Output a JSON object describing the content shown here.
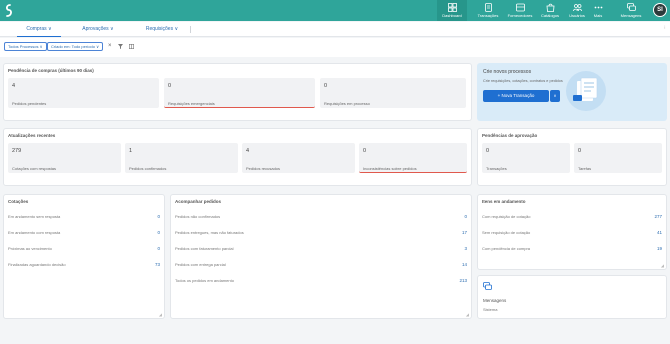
{
  "nav": {
    "items": [
      {
        "label": "Dashboard",
        "icon": "dashboard-icon"
      },
      {
        "label": "Transações",
        "icon": "transactions-icon"
      },
      {
        "label": "Fornecedores",
        "icon": "suppliers-icon"
      },
      {
        "label": "Catálogos",
        "icon": "catalog-icon"
      },
      {
        "label": "Usuários",
        "icon": "users-icon"
      },
      {
        "label": "Mais",
        "icon": "more-icon"
      },
      {
        "label": "Mensagens",
        "icon": "messages-icon"
      }
    ],
    "avatar": "SI"
  },
  "tabs": [
    {
      "label": "Compras ∨"
    },
    {
      "label": "Aprovações ∨"
    },
    {
      "label": "Requisições ∨"
    }
  ],
  "tabs_more": "⁝",
  "filters": {
    "scope": "Todos Processos ∨",
    "period": "Criado em: Todo período ∨"
  },
  "pendencias": {
    "title": "Pendência de compras (últimos 90 dias)",
    "stats": [
      {
        "value": "4",
        "label": "Pedidos pendentes"
      },
      {
        "value": "0",
        "label": "Requisições emergenciais"
      },
      {
        "value": "0",
        "label": "Requisições em processo"
      }
    ]
  },
  "promo": {
    "title": "Crie novos processos",
    "subtitle": "Crie requisições, cotações, contratos e pedidos",
    "button": "+ Nova Transação",
    "dropdown": "∨"
  },
  "atualizacoes": {
    "title": "Atualizações recentes",
    "stats": [
      {
        "value": "279",
        "label": "Cotações com respostas"
      },
      {
        "value": "1",
        "label": "Pedidos confirmados"
      },
      {
        "value": "4",
        "label": "Pedidos recusados"
      },
      {
        "value": "0",
        "label": "Inconsistências sobre pedidos"
      }
    ]
  },
  "aprovacao": {
    "title": "Pendências de aprovação",
    "stats": [
      {
        "value": "0",
        "label": "Transações"
      },
      {
        "value": "0",
        "label": "Tarefas"
      }
    ]
  },
  "cotacoes": {
    "title": "Cotações",
    "rows": [
      {
        "label": "Em andamento sem resposta",
        "value": "0"
      },
      {
        "label": "Em andamento com resposta",
        "value": "0"
      },
      {
        "label": "Próximas ao vencimento",
        "value": "0"
      },
      {
        "label": "Finalizadas aguardando decisão",
        "value": "73"
      }
    ]
  },
  "acompanhar": {
    "title": "Acompanhar pedidos",
    "rows": [
      {
        "label": "Pedidos não confirmados",
        "value": "0"
      },
      {
        "label": "Pedidos entregues, mas não faturados",
        "value": "17"
      },
      {
        "label": "Pedidos com faturamento parcial",
        "value": "3"
      },
      {
        "label": "Pedidos com entrega parcial",
        "value": "14"
      },
      {
        "label": "Todos os pedidos em andamento",
        "value": "213"
      }
    ]
  },
  "andamento": {
    "title": "Itens em andamento",
    "rows": [
      {
        "label": "Com requisição de cotação",
        "value": "277"
      },
      {
        "label": "Sem requisição de cotação",
        "value": "41"
      },
      {
        "label": "Com pendência de compra",
        "value": "19"
      }
    ]
  },
  "mensagens": {
    "title": "Mensagens",
    "subtitle": "Sistema"
  },
  "colors": {
    "brand": "#2fa59a",
    "accent": "#1f6fd1",
    "alert": "#e0594d"
  }
}
